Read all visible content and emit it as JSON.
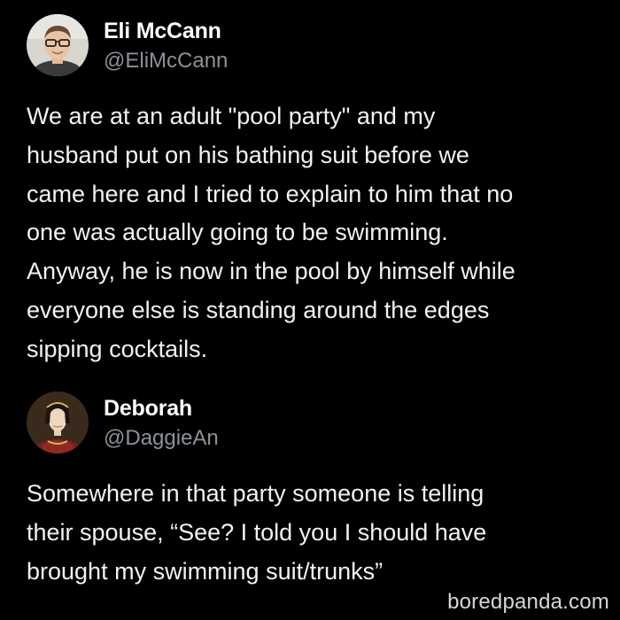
{
  "tweets": [
    {
      "author_name": "Eli McCann",
      "author_handle": "@EliMcCann",
      "avatar_icon": "man-with-glasses-avatar",
      "text": "We are at an adult \"pool party\" and my\nhusband put on his bathing suit before we\ncame here and I tried to explain to him that no\none was actually going to be swimming.\nAnyway, he is now in the pool by himself while\neveryone else is standing around the edges\nsipping cocktails."
    },
    {
      "author_name": "Deborah",
      "author_handle": "@DaggieAn",
      "avatar_icon": "tudor-portrait-avatar",
      "text": "Somewhere in that party someone is telling\ntheir spouse, “See?  I told you I should have\nbrought my swimming suit/trunks”"
    }
  ],
  "watermark": "boredpanda.com",
  "colors": {
    "background": "#000000",
    "text": "#f2f2f2",
    "handle": "#8b9298"
  }
}
